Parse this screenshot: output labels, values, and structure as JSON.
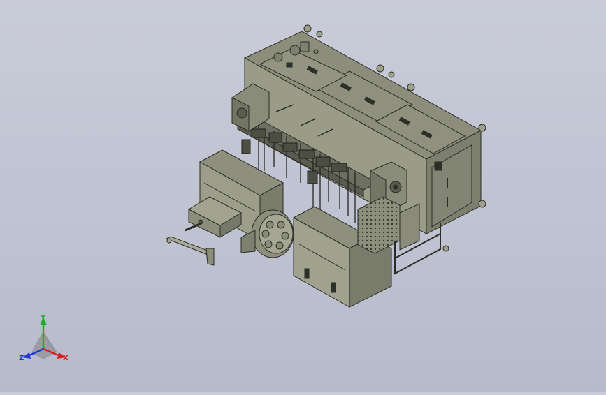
{
  "viewport": {
    "background_top": "#c9ccd8",
    "background_bottom": "#b6bacb"
  },
  "model": {
    "body_color": "#8f917f",
    "shadow_color": "#6b6d5f",
    "light_color": "#a6a893",
    "line_color": "#2b2c26"
  },
  "triad": {
    "x_label": "X",
    "y_label": "Y",
    "z_label": "Z",
    "x_color": "#d21f1f",
    "y_color": "#1fae2c",
    "z_color": "#2038d8"
  }
}
